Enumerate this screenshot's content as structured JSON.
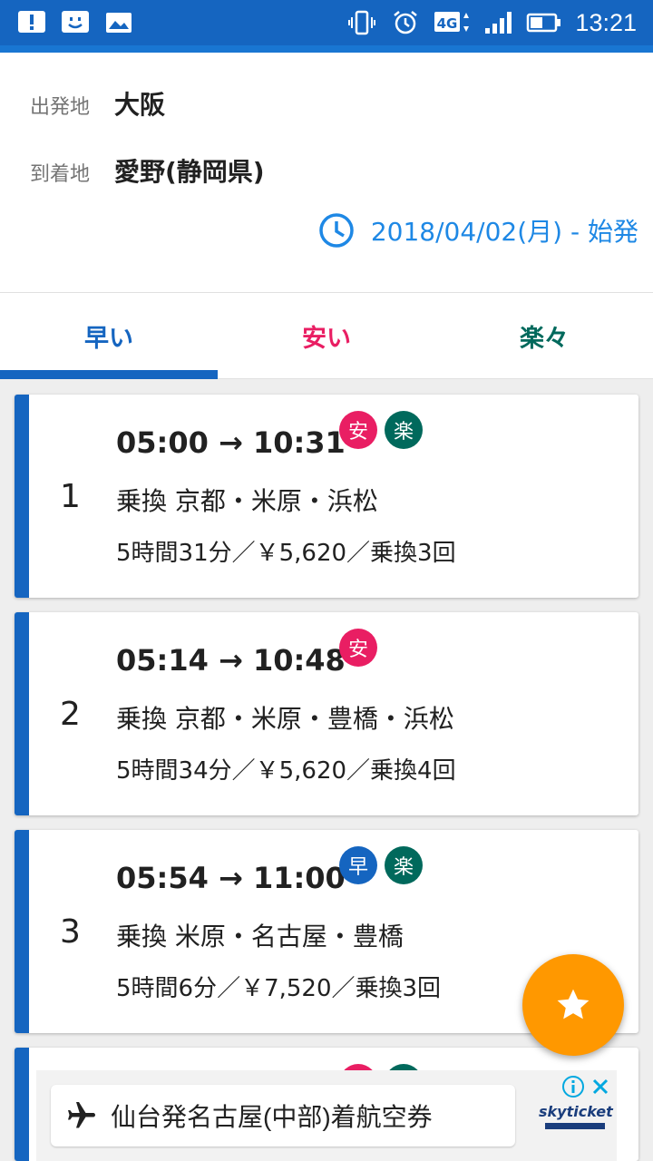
{
  "status_bar": {
    "network": "4G",
    "time": "13:21"
  },
  "search": {
    "from_label": "出発地",
    "from_value": "大阪",
    "to_label": "到着地",
    "to_value": "愛野(静岡県)",
    "datetime": "2018/04/02(月) - 始発"
  },
  "tabs": [
    {
      "label": "早い",
      "color": "#1565c0",
      "selected": true
    },
    {
      "label": "安い",
      "color": "#e91e63",
      "selected": false
    },
    {
      "label": "楽々",
      "color": "#00695c",
      "selected": false
    }
  ],
  "badge_colors": {
    "安": "#e91e63",
    "楽": "#00695c",
    "早": "#1565c0"
  },
  "routes": [
    {
      "number": "1",
      "times": "05:00 → 10:31",
      "badges": [
        "安",
        "楽"
      ],
      "transfers": "乗換  京都・米原・浜松",
      "summary": "5時間31分／￥5,620／乗換3回"
    },
    {
      "number": "2",
      "times": "05:14 → 10:48",
      "badges": [
        "安"
      ],
      "transfers": "乗換  京都・米原・豊橋・浜松",
      "summary": "5時間34分／￥5,620／乗換4回"
    },
    {
      "number": "3",
      "times": "05:54 → 11:00",
      "badges": [
        "早",
        "楽"
      ],
      "transfers": "乗換  米原・名古屋・豊橋",
      "summary": "5時間6分／￥7,520／乗換3回"
    }
  ],
  "fab": {
    "icon": "star-icon"
  },
  "ad": {
    "text": "仙台発名古屋(中部)着航空券",
    "brand": "skyticket"
  }
}
